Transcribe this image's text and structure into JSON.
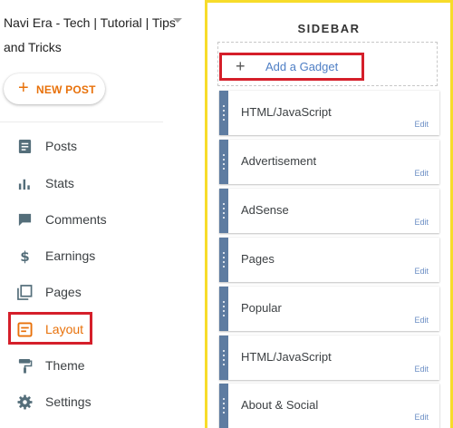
{
  "blog": {
    "title": "Navi Era - Tech | Tutorial | Tips and Tricks"
  },
  "new_post": {
    "label": "NEW POST"
  },
  "nav": {
    "items": [
      {
        "label": "Posts",
        "icon": "posts-icon"
      },
      {
        "label": "Stats",
        "icon": "stats-icon"
      },
      {
        "label": "Comments",
        "icon": "comments-icon"
      },
      {
        "label": "Earnings",
        "icon": "dollar-icon"
      },
      {
        "label": "Pages",
        "icon": "pages-icon"
      },
      {
        "label": "Layout",
        "icon": "layout-icon",
        "active": true
      },
      {
        "label": "Theme",
        "icon": "paint-roller-icon"
      },
      {
        "label": "Settings",
        "icon": "gear-icon"
      }
    ]
  },
  "sidebar": {
    "title": "SIDEBAR",
    "add_gadget_label": "Add a Gadget",
    "edit_label": "Edit",
    "gadgets": [
      {
        "name": "HTML/JavaScript"
      },
      {
        "name": "Advertisement"
      },
      {
        "name": "AdSense"
      },
      {
        "name": "Pages"
      },
      {
        "name": "Popular"
      },
      {
        "name": "HTML/JavaScript"
      },
      {
        "name": "About & Social"
      }
    ]
  },
  "colors": {
    "accent": "#e8710a",
    "highlight_border": "#d51f2a",
    "panel_border": "#f7dc2a",
    "handle": "#5e7ca1",
    "link": "#4f7fc5"
  }
}
